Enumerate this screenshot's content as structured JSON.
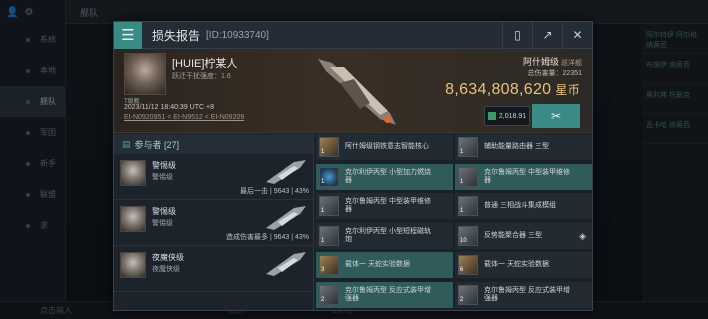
{
  "background": {
    "top_left_title": "舰队",
    "sidebar": [
      "系统",
      "本地",
      "舰队",
      "军团",
      "新手",
      "联盟",
      "求"
    ],
    "active_index": 2,
    "right_list": [
      "阿尔特伊 阿尔格 纳黄芭",
      "布姆伊 纳黄芭",
      "奥利弗 托勒克",
      "瓦卡哈 纳黄芭"
    ],
    "bottom_send": "发送",
    "bottom_placeholder": "点击输入",
    "bottom_counter": "0米/秒"
  },
  "dialog": {
    "title": "损失报告",
    "report_id": "[ID:10933740]",
    "icons": [
      "document-icon",
      "share-icon",
      "close-icon"
    ]
  },
  "victim": {
    "name": "[HUIE]柠某人",
    "danger_label": "跃迁干扰强度：1.6",
    "level": "T级舰",
    "datetime": "2023/11/12 18:40:39 UTC +8",
    "route": "EI-N0920951 < EI-N9512 < EI-N09209",
    "ship_class": "阿什姆级",
    "ship_type": "巡洋舰",
    "total_damage": "总伤害量：22351",
    "isk_value": "8,634,808,620",
    "isk_unit": "星币",
    "badge_value": "2,018.91"
  },
  "participants": {
    "header": "参与者 [27]",
    "rows": [
      {
        "ship1": "警惕级",
        "ship2": "警惕级",
        "stat": "最后一击 | 9643 | 43%"
      },
      {
        "ship1": "警惕级",
        "ship2": "警惕级",
        "stat": "造成伤害最多 | 9643 | 43%"
      },
      {
        "ship1": "夜魔侠级",
        "ship2": "夜魔侠级",
        "stat": ""
      }
    ]
  },
  "items": [
    {
      "qty": "1",
      "text": "阿什姆级钢铁意志智能核心",
      "style": "dk",
      "col": 0,
      "row": 0,
      "ic": "gold"
    },
    {
      "qty": "1",
      "text": "辅助能量路由器 三型",
      "style": "dk",
      "col": 1,
      "row": 0,
      "ic": "grey"
    },
    {
      "qty": "1",
      "text": "克尔利伊丙型 小型加力燃烧器",
      "style": "hl",
      "col": 0,
      "row": 1,
      "ic": "blue"
    },
    {
      "qty": "1",
      "text": "克尔鲁姆丙型 中型装甲维修器",
      "style": "hl",
      "col": 1,
      "row": 1,
      "ic": "grey"
    },
    {
      "qty": "1",
      "text": "克尔鲁姆丙型 中型装甲维修器",
      "style": "dk",
      "col": 0,
      "row": 2,
      "ic": "grey"
    },
    {
      "qty": "1",
      "text": "普通 三相战斗集成模组",
      "style": "dk",
      "col": 1,
      "row": 2,
      "ic": "grey"
    },
    {
      "qty": "1",
      "text": "克尔利伊丙型 小型短程磁轨炮",
      "style": "dk",
      "col": 0,
      "row": 3,
      "ic": "grey"
    },
    {
      "qty": "10",
      "text": "反势能聚合器 三型",
      "style": "dk",
      "col": 1,
      "row": 3,
      "ic": "grey",
      "ext": "◈"
    },
    {
      "qty": "3",
      "text": "载体一 天蛇实验数据",
      "style": "hl",
      "col": 0,
      "row": 4,
      "ic": "gold"
    },
    {
      "qty": "6",
      "text": "载体一 天蛇实验数据",
      "style": "dk",
      "col": 1,
      "row": 4,
      "ic": "gold"
    },
    {
      "qty": "2",
      "text": "克尔鲁姆丙型 反应式装甲增强器",
      "style": "hl",
      "col": 0,
      "row": 5,
      "ic": "grey"
    },
    {
      "qty": "2",
      "text": "克尔鲁姆丙型 反应式装甲增强器",
      "style": "dk",
      "col": 1,
      "row": 5,
      "ic": "grey"
    }
  ],
  "colors": {
    "accent": "#3a8a85",
    "isk": "#e9c27a",
    "highlight_row": "#2f5b5a"
  }
}
